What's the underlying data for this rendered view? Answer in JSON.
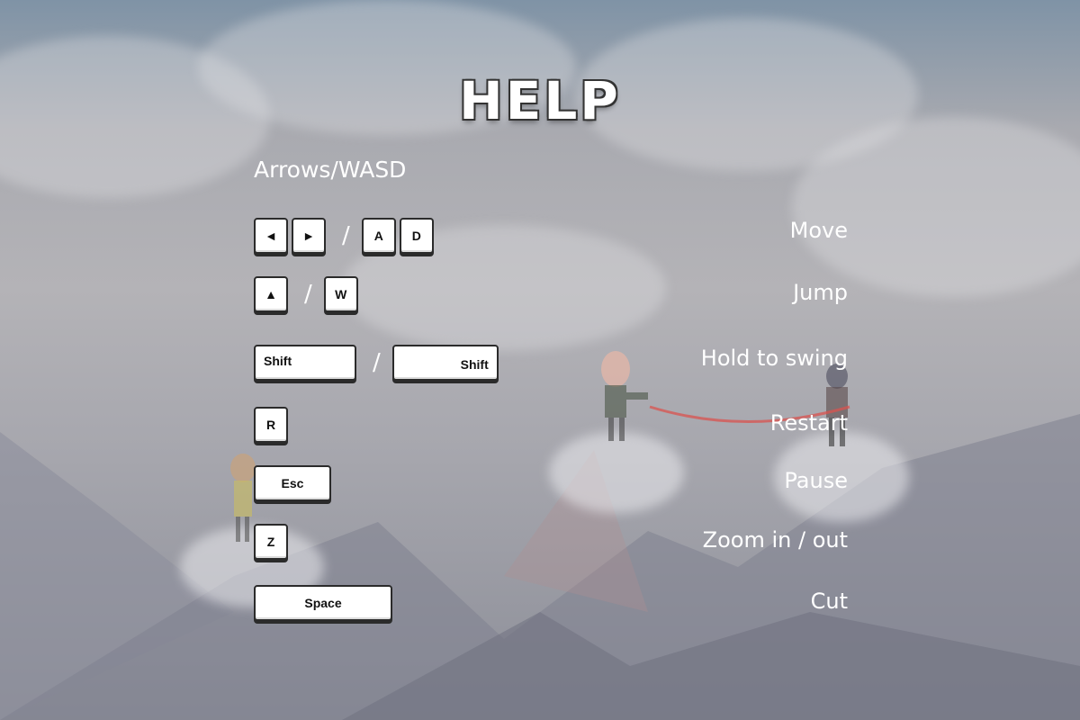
{
  "title": "HELP",
  "subtitle": "Arrows/WASD",
  "controls": [
    {
      "keys": [
        "◄",
        "►",
        "/",
        "A",
        "D"
      ],
      "action": "Move"
    },
    {
      "keys": [
        "▲",
        "/",
        "W"
      ],
      "action": "Jump"
    },
    {
      "keys": [
        "Shift",
        "/",
        "Shift"
      ],
      "action": "Hold to swing"
    },
    {
      "keys": [
        "R"
      ],
      "action": "Restart"
    },
    {
      "keys": [
        "Esc"
      ],
      "action": "Pause"
    },
    {
      "keys": [
        "Z"
      ],
      "action": "Zoom in / out"
    },
    {
      "keys": [
        "Space"
      ],
      "action": "Cut"
    }
  ],
  "colors": {
    "rope": "#d9534f",
    "text": "#ffffff",
    "key_border": "#2b2b2b"
  }
}
